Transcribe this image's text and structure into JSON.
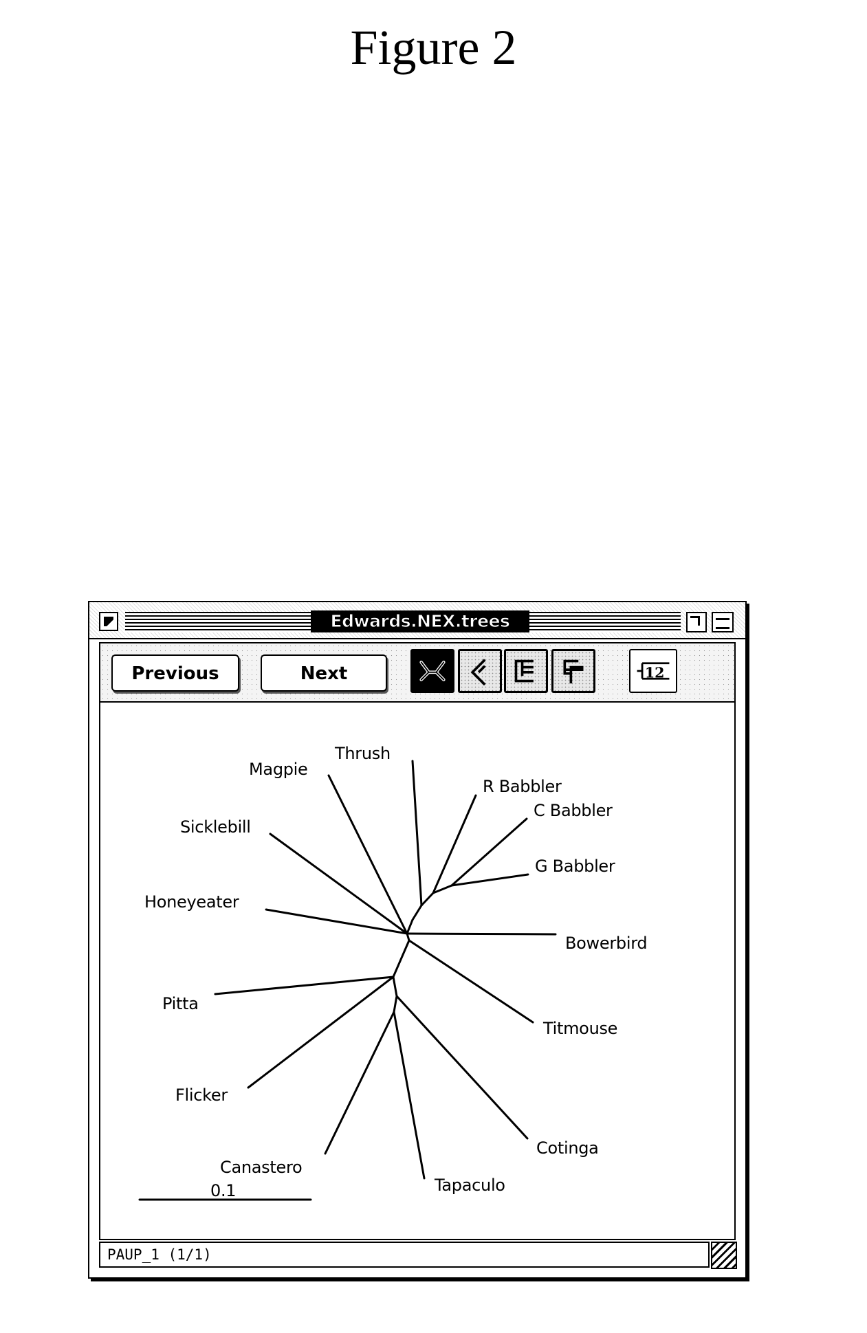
{
  "figure": {
    "title": "Figure 2"
  },
  "window": {
    "title": "Edwards.NEX.trees",
    "toolbar": {
      "previous_label": "Previous",
      "next_label": "Next",
      "view_buttons": [
        {
          "name": "radial-tree",
          "selected": true
        },
        {
          "name": "slanted-tree",
          "selected": false
        },
        {
          "name": "phylogram-tree",
          "selected": false
        },
        {
          "name": "cladogram-tree",
          "selected": false
        }
      ],
      "node-label-button": {
        "text": "12"
      }
    },
    "status": "PAUP_1  (1/1)"
  },
  "tree": {
    "type": "unrooted-radial",
    "scale_bar_label": "0.1",
    "taxa": [
      "Thrush",
      "Magpie",
      "Sicklebill",
      "Honeyeater",
      "R Babbler",
      "C Babbler",
      "G Babbler",
      "Bowerbird",
      "Titmouse",
      "Pitta",
      "Flicker",
      "Canastero",
      "Tapaculo",
      "Cotinga"
    ]
  }
}
